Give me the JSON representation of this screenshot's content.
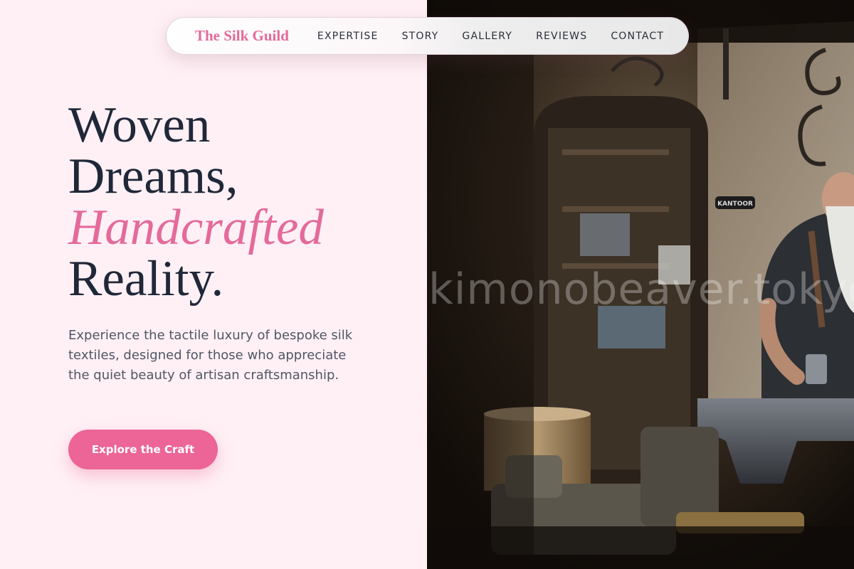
{
  "brand": {
    "name": "The Silk Guild"
  },
  "nav": {
    "items": [
      {
        "label": "EXPERTISE"
      },
      {
        "label": "STORY"
      },
      {
        "label": "GALLERY"
      },
      {
        "label": "REVIEWS"
      },
      {
        "label": "CONTACT"
      }
    ]
  },
  "hero": {
    "title_line1": "Woven",
    "title_line2": "Dreams,",
    "title_accent": "Handcrafted",
    "title_line4": "Reality.",
    "description": "Experience the tactile luxury of bespoke silk textiles, designed for those who appreciate the quiet beauty of artisan craftsmanship.",
    "cta_label": "Explore the Craft"
  },
  "photo": {
    "watermark": "kimonobeaver.tokyo",
    "sign_text": "KANTOOR"
  },
  "colors": {
    "accent": "#e46a9a",
    "button": "#ec6596",
    "text_dark": "#1f2838",
    "text_muted": "#515665",
    "background": "#fff0f5"
  }
}
